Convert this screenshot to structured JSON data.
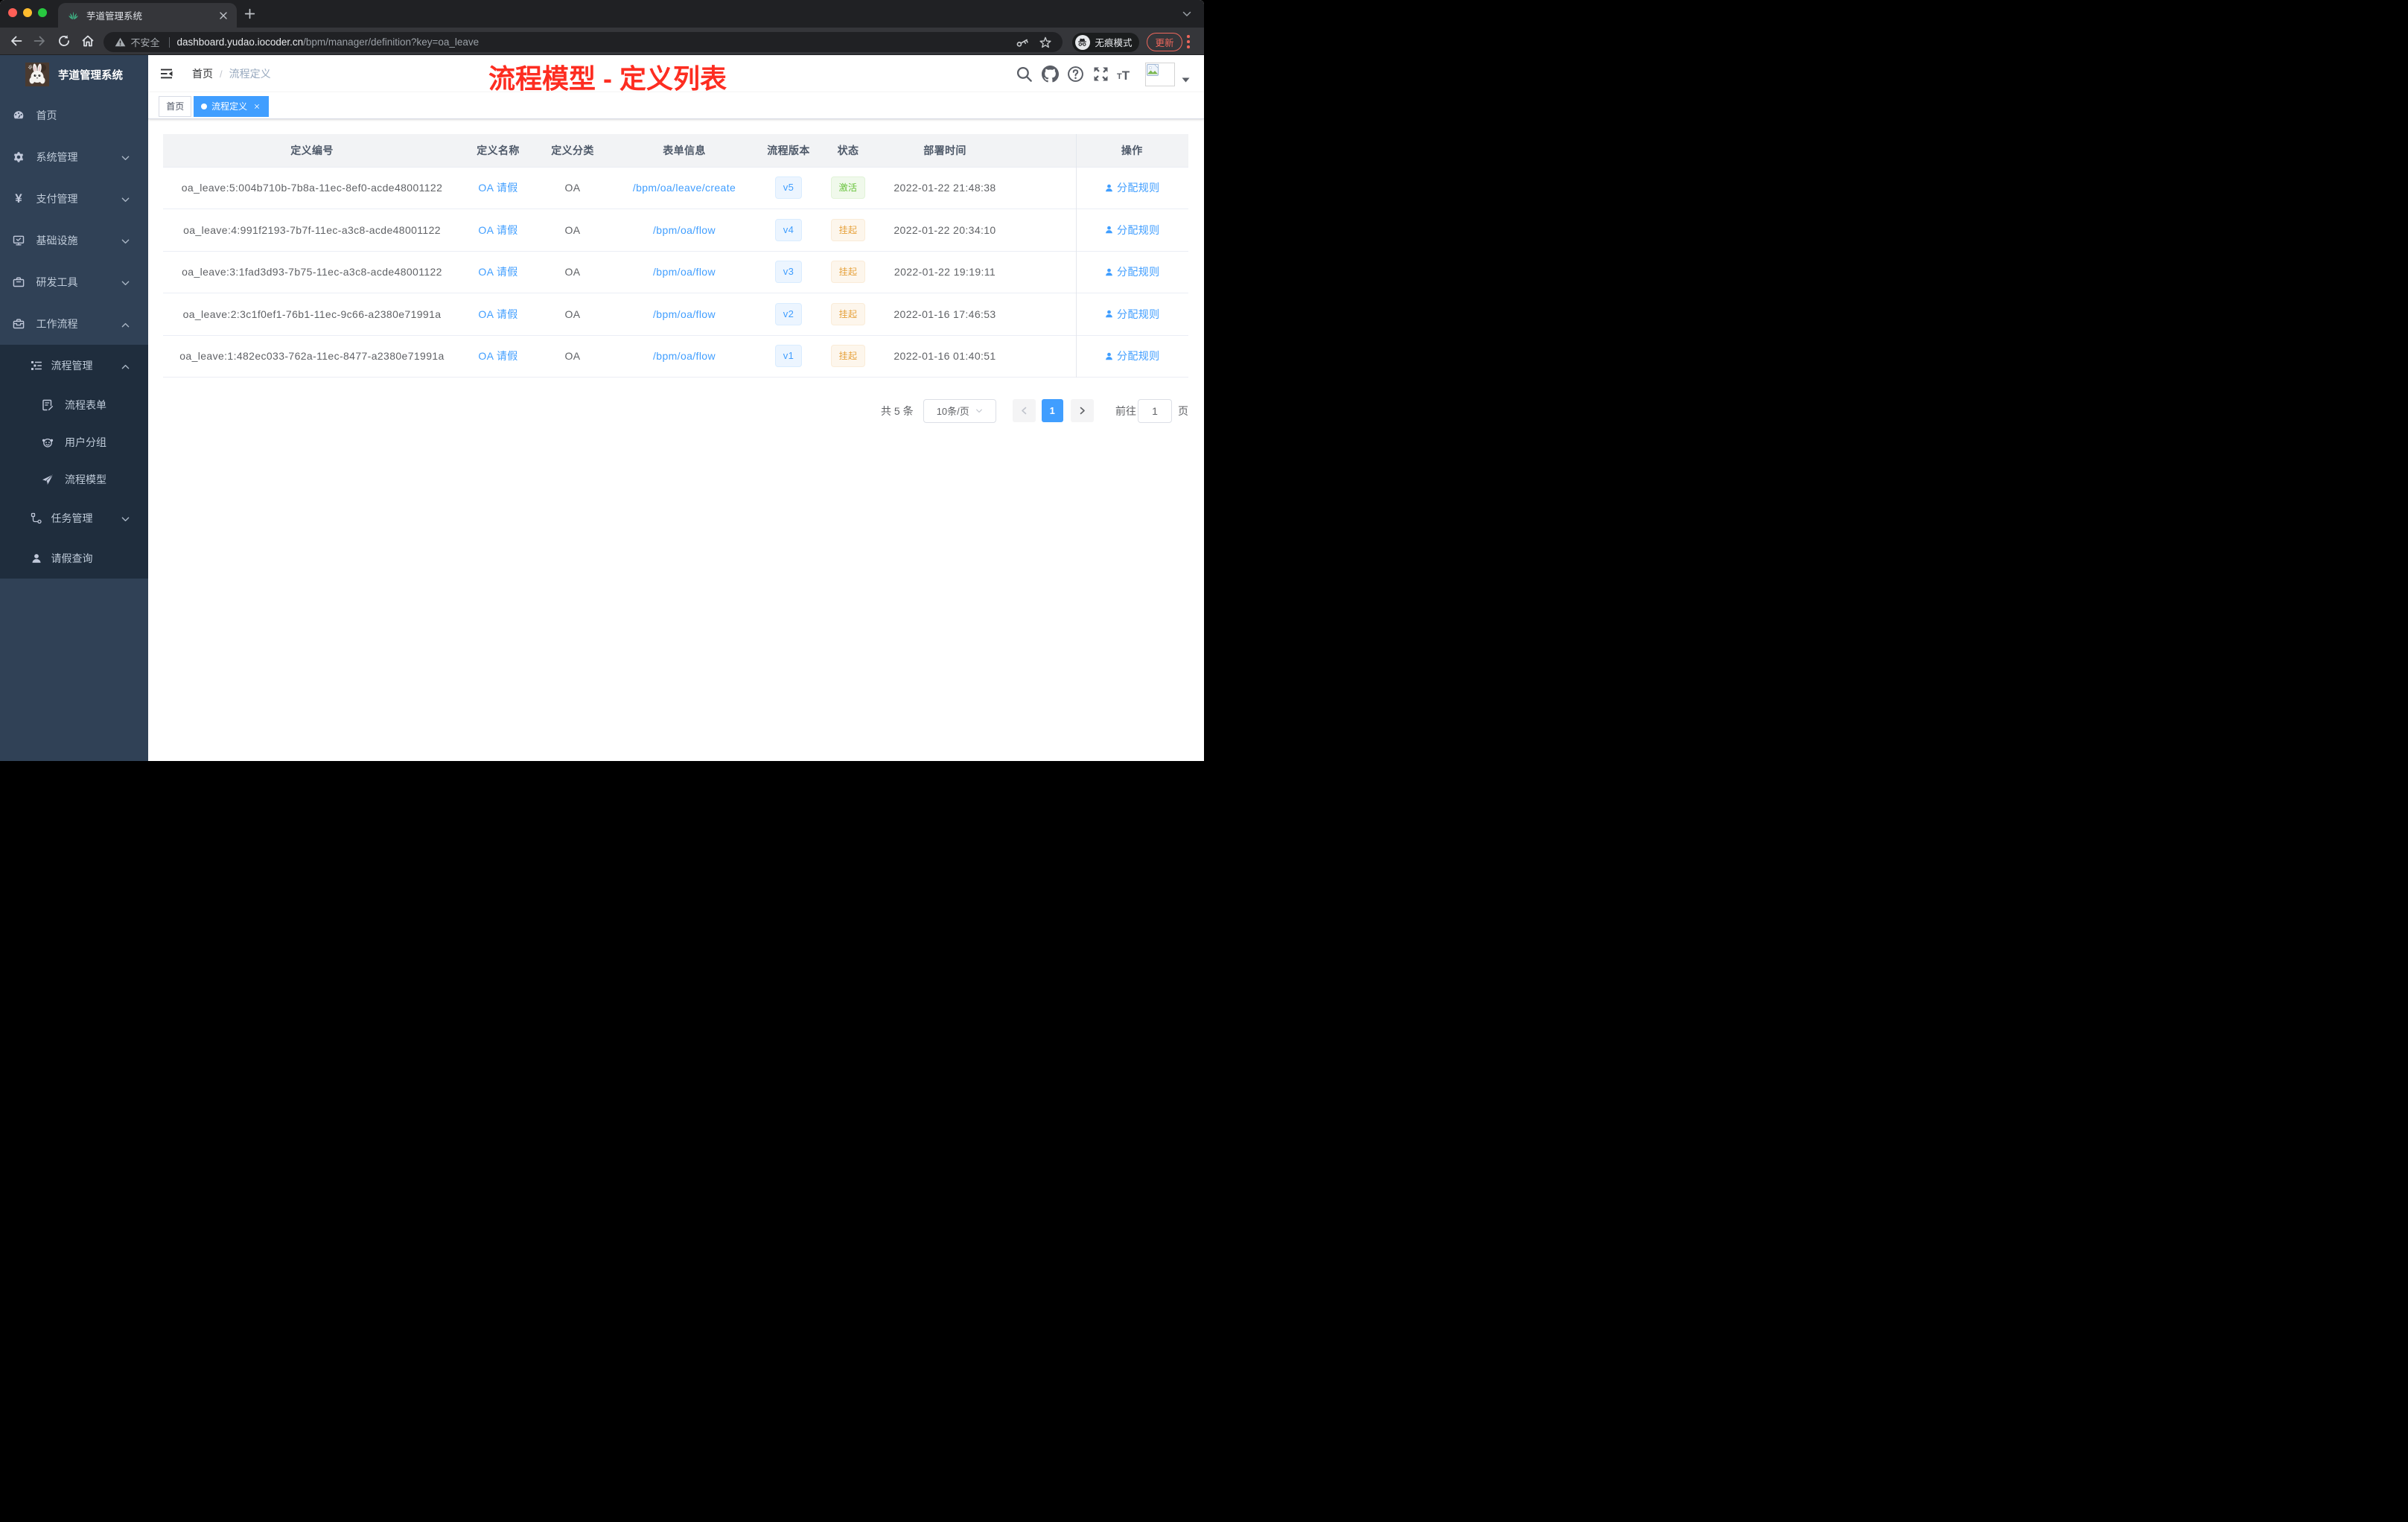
{
  "browser": {
    "tab_title": "芋道管理系统",
    "tab_close": "×",
    "security_label": "不安全",
    "url_host": "dashboard.yudao.iocoder.cn",
    "url_path": "/bpm/manager/definition?key=oa_leave",
    "incognito_label": "无痕模式",
    "update_label": "更新"
  },
  "sidebar": {
    "logo_title": "芋道管理系统",
    "menu": [
      {
        "label": "首页",
        "icon": "dashboard-icon"
      },
      {
        "label": "系统管理",
        "icon": "gear-icon"
      },
      {
        "label": "支付管理",
        "icon": "yen-icon"
      },
      {
        "label": "基础设施",
        "icon": "monitor-icon"
      },
      {
        "label": "研发工具",
        "icon": "briefcase-icon"
      },
      {
        "label": "工作流程",
        "icon": "toolbox-icon"
      }
    ],
    "submenu": [
      {
        "label": "流程管理",
        "icon": "tree-icon"
      },
      {
        "label": "流程表单",
        "icon": "form-icon"
      },
      {
        "label": "用户分组",
        "icon": "face-icon"
      },
      {
        "label": "流程模型",
        "icon": "send-icon"
      },
      {
        "label": "任务管理",
        "icon": "branch-icon"
      },
      {
        "label": "请假查询",
        "icon": "user-icon"
      }
    ]
  },
  "header": {
    "breadcrumb_home": "首页",
    "breadcrumb_separator": "/",
    "breadcrumb_current": "流程定义",
    "annotation": "流程模型 - 定义列表",
    "annotation_color": "#fd2d21"
  },
  "tags": {
    "home": "首页",
    "active": "流程定义",
    "close": "×"
  },
  "table": {
    "columns": [
      "定义编号",
      "定义名称",
      "定义分类",
      "表单信息",
      "流程版本",
      "状态",
      "部署时间",
      "操作"
    ],
    "rows": [
      {
        "id": "oa_leave:5:004b710b-7b8a-11ec-8ef0-acde48001122",
        "name": "OA 请假",
        "category": "OA",
        "form": "/bpm/oa/leave/create",
        "version": "v5",
        "status": "激活",
        "status_type": "success",
        "time": "2022-01-22 21:48:38",
        "action": "分配规则"
      },
      {
        "id": "oa_leave:4:991f2193-7b7f-11ec-a3c8-acde48001122",
        "name": "OA 请假",
        "category": "OA",
        "form": "/bpm/oa/flow",
        "version": "v4",
        "status": "挂起",
        "status_type": "warning",
        "time": "2022-01-22 20:34:10",
        "action": "分配规则"
      },
      {
        "id": "oa_leave:3:1fad3d93-7b75-11ec-a3c8-acde48001122",
        "name": "OA 请假",
        "category": "OA",
        "form": "/bpm/oa/flow",
        "version": "v3",
        "status": "挂起",
        "status_type": "warning",
        "time": "2022-01-22 19:19:11",
        "action": "分配规则"
      },
      {
        "id": "oa_leave:2:3c1f0ef1-76b1-11ec-9c66-a2380e71991a",
        "name": "OA 请假",
        "category": "OA",
        "form": "/bpm/oa/flow",
        "version": "v2",
        "status": "挂起",
        "status_type": "warning",
        "time": "2022-01-16 17:46:53",
        "action": "分配规则"
      },
      {
        "id": "oa_leave:1:482ec033-762a-11ec-8477-a2380e71991a",
        "name": "OA 请假",
        "category": "OA",
        "form": "/bpm/oa/flow",
        "version": "v1",
        "status": "挂起",
        "status_type": "warning",
        "time": "2022-01-16 01:40:51",
        "action": "分配规则"
      }
    ]
  },
  "pagination": {
    "total": "共 5 条",
    "page_size": "10条/页",
    "current_page": "1",
    "goto_label": "前往",
    "goto_value": "1",
    "unit_label": "页"
  },
  "colors": {
    "accent": "#409eff",
    "sidebar_bg": "#304156",
    "submenu_bg": "#1f2d3d",
    "success": "#67c23a",
    "warning": "#e6a23c",
    "update_chip": "#ee675c",
    "annotation_red": "#fd2d21"
  }
}
